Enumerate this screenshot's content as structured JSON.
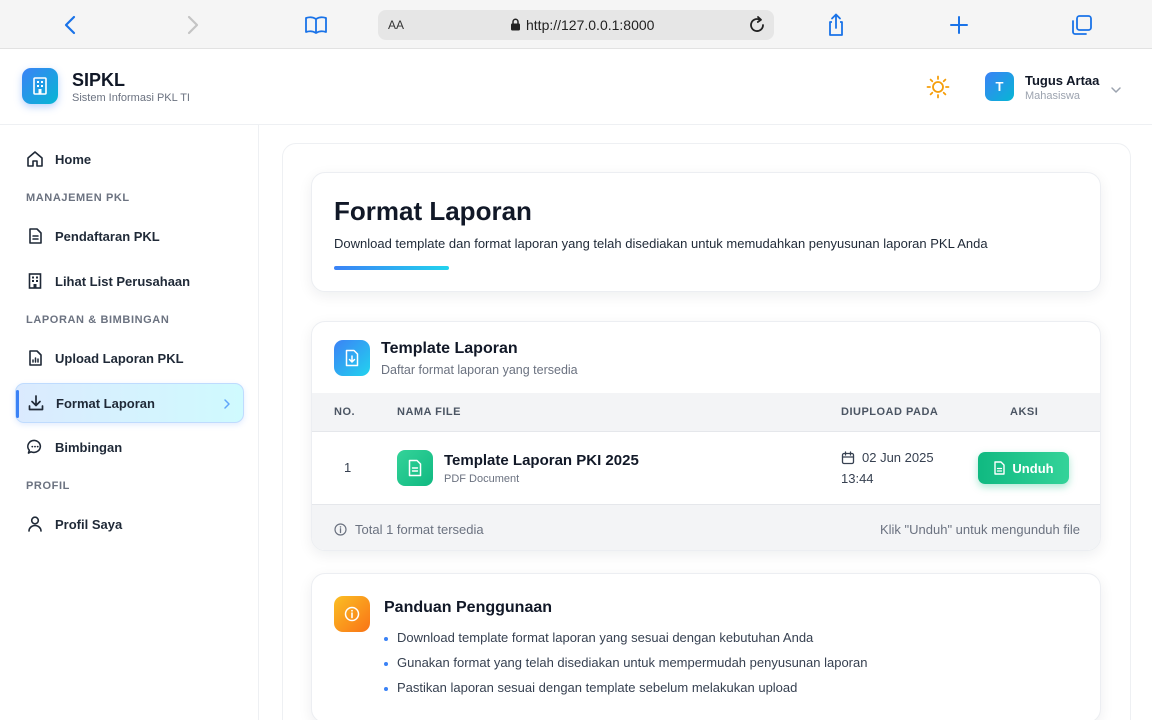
{
  "browser": {
    "aa_label": "AA",
    "url": "http://127.0.0.1:8000"
  },
  "header": {
    "brand_title": "SIPKL",
    "brand_subtitle": "Sistem Informasi PKL TI",
    "user_initial": "T",
    "user_name": "Tugus Artaa",
    "user_role": "Mahasiswa"
  },
  "sidebar": {
    "home_label": "Home",
    "sections": [
      "MANAJEMEN PKL",
      "LAPORAN & BIMBINGAN",
      "PROFIL"
    ],
    "items": [
      {
        "label": "Pendaftaran PKL",
        "icon": "document-icon"
      },
      {
        "label": "Lihat List Perusahaan",
        "icon": "building-icon"
      },
      {
        "label": "Upload Laporan PKL",
        "icon": "file-chart-icon"
      },
      {
        "label": "Format Laporan",
        "icon": "download-icon",
        "active": true
      },
      {
        "label": "Bimbingan",
        "icon": "chat-icon"
      },
      {
        "label": "Profil Saya",
        "icon": "user-icon"
      }
    ]
  },
  "hero": {
    "title": "Format Laporan",
    "description": "Download template dan format laporan yang telah disediakan untuk memudahkan penyusunan laporan PKL Anda"
  },
  "template_card": {
    "title": "Template Laporan",
    "subtitle": "Daftar format laporan yang tersedia",
    "columns": [
      "NO.",
      "NAMA FILE",
      "DIUPLOAD PADA",
      "AKSI"
    ],
    "rows": [
      {
        "no": "1",
        "file_name": "Template Laporan PKI 2025",
        "file_type": "PDF Document",
        "date": "02 Jun 2025",
        "time": "13:44",
        "action_label": "Unduh"
      }
    ],
    "footer_total": "Total 1 format tersedia",
    "footer_hint": "Klik \"Unduh\" untuk mengunduh file"
  },
  "guide_card": {
    "title": "Panduan Penggunaan",
    "items": [
      "Download template format laporan yang sesuai dengan kebutuhan Anda",
      "Gunakan format yang telah disediakan untuk mempermudah penyusunan laporan",
      "Pastikan laporan sesuai dengan template sebelum melakukan upload"
    ]
  },
  "colors": {
    "primary": "#3b82f6",
    "accent": "#22d3ee",
    "success": "#10b981",
    "warning": "#f59e0b"
  }
}
